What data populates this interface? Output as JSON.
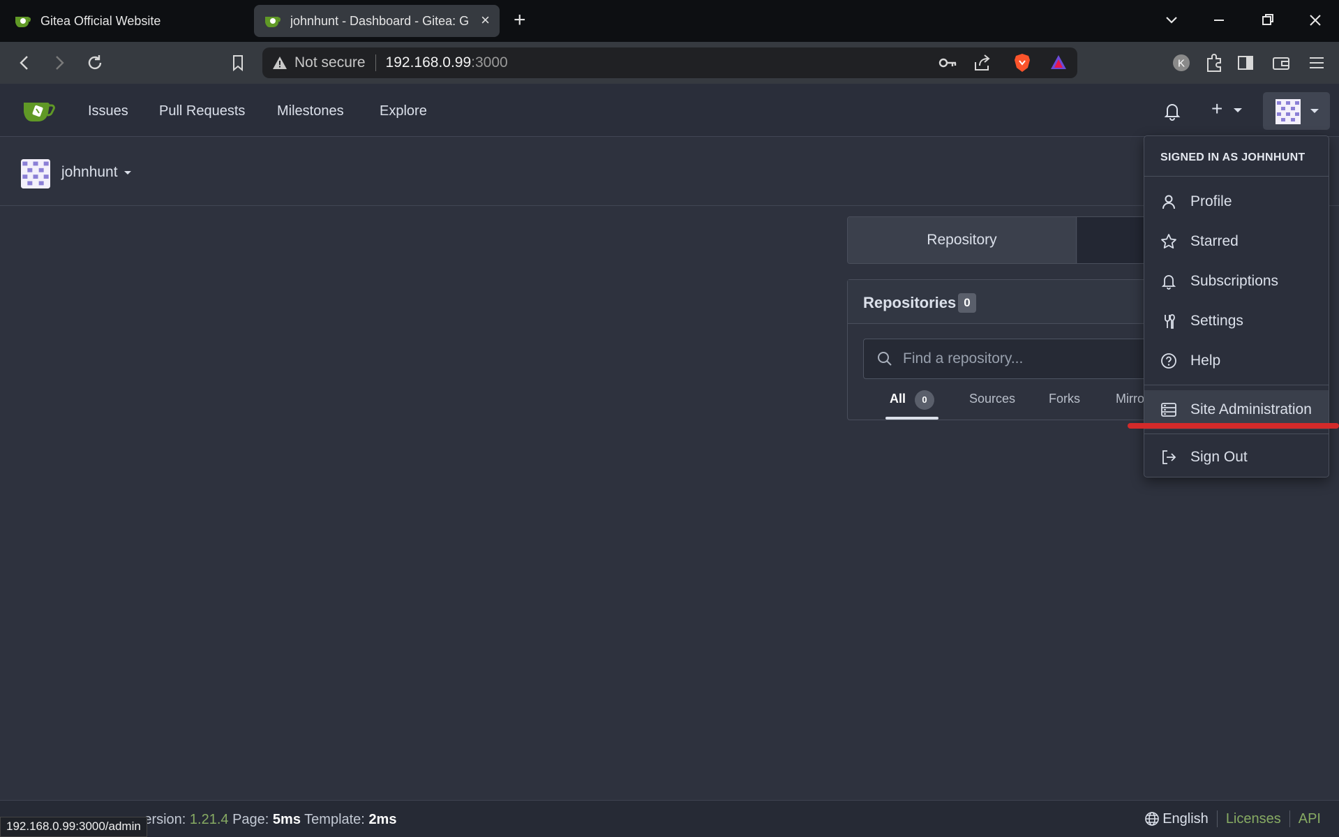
{
  "browser": {
    "tabs": [
      {
        "title": "Gitea Official Website",
        "active": false
      },
      {
        "title": "johnhunt - Dashboard - Gitea: G",
        "active": true
      }
    ],
    "close_icon": "×",
    "new_tab_icon": "+",
    "address": {
      "security_label": "Not secure",
      "host": "192.168.0.99",
      "port": ":3000"
    },
    "profile_initial": "K"
  },
  "gitea_nav": {
    "items": [
      "Issues",
      "Pull Requests",
      "Milestones",
      "Explore"
    ],
    "create_icon": "+"
  },
  "context": {
    "user": "johnhunt"
  },
  "dashboard": {
    "segment_repository": "Repository",
    "repos_title": "Repositories",
    "repos_count": "0",
    "search_placeholder": "Find a repository...",
    "filters": {
      "all": "All",
      "all_count": "0",
      "sources": "Sources",
      "forks": "Forks",
      "mirrors": "Mirro"
    }
  },
  "user_menu": {
    "header": "SIGNED IN AS JOHNHUNT",
    "items": {
      "profile": "Profile",
      "starred": "Starred",
      "subscriptions": "Subscriptions",
      "settings": "Settings",
      "help": "Help",
      "site_admin": "Site Administration",
      "sign_out": "Sign Out"
    }
  },
  "footer": {
    "version_prefix": "ersion:",
    "version": "1.21.4",
    "page_label": "Page:",
    "page_time": "5ms",
    "template_label": "Template:",
    "template_time": "2ms",
    "language": "English",
    "licenses": "Licenses",
    "api": "API"
  },
  "status_url": "192.168.0.99:3000/admin",
  "colors": {
    "background": "#2e323e",
    "accent_green": "#87ab63",
    "annotation_red": "#d32a2a"
  }
}
